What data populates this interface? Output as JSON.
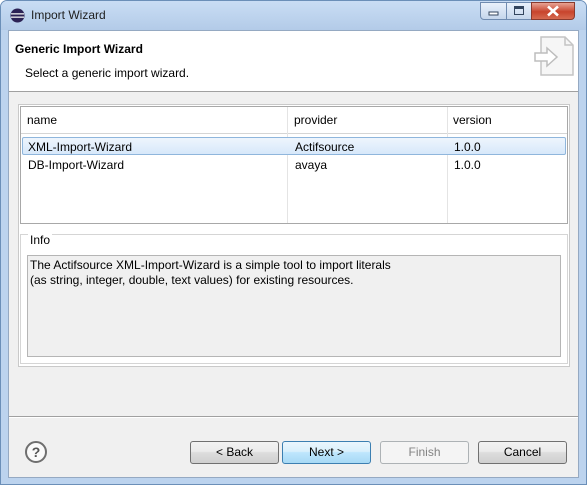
{
  "window": {
    "title": "Import Wizard",
    "icon": "eclipse-icon"
  },
  "header": {
    "title": "Generic Import Wizard",
    "description": "Select a generic import wizard.",
    "image": "import-wizard-banner-icon"
  },
  "table": {
    "columns": [
      "name",
      "provider",
      "version"
    ],
    "rows": [
      {
        "name": "XML-Import-Wizard",
        "provider": "Actifsource",
        "version": "1.0.0",
        "selected": true
      },
      {
        "name": "DB-Import-Wizard",
        "provider": "avaya",
        "version": "1.0.0",
        "selected": false
      }
    ]
  },
  "info": {
    "label": "Info",
    "lines": [
      "The Actifsource XML-Import-Wizard is a simple tool to import literals",
      "(as string, integer, double, text values) for existing resources."
    ]
  },
  "buttons": {
    "help": "?",
    "back": "< Back",
    "next": "Next >",
    "finish": "Finish",
    "cancel": "Cancel"
  },
  "colors": {
    "titlebar": "#c9ddf4",
    "selection": "#d7e8fa",
    "default_button_border": "#3c7fb1"
  }
}
